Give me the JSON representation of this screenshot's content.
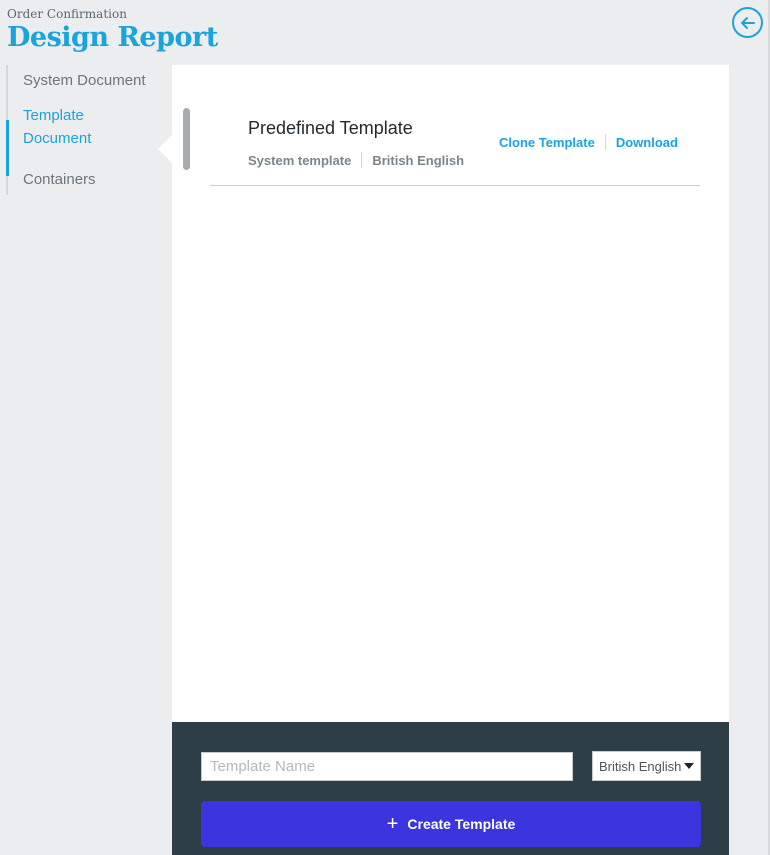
{
  "header": {
    "subtitle": "Order Confirmation",
    "title": "Design Report"
  },
  "sidebar": {
    "items": [
      {
        "label": "System Document"
      },
      {
        "label": "Template Document"
      },
      {
        "label": "Containers"
      }
    ],
    "active_index": 1
  },
  "template": {
    "title": "Predefined Template",
    "type": "System template",
    "language": "British English",
    "clone_label": "Clone Template",
    "download_label": "Download"
  },
  "footer": {
    "name_placeholder": "Template Name",
    "language_value": "British English",
    "create_label": "Create Template"
  },
  "icons": {
    "back": "back-arrow-circle-icon",
    "plus": "plus-icon",
    "dropdown": "caret-down-icon"
  },
  "colors": {
    "accent": "#1ba3dd",
    "button": "#3b35e0",
    "footer": "#2d3e47"
  }
}
